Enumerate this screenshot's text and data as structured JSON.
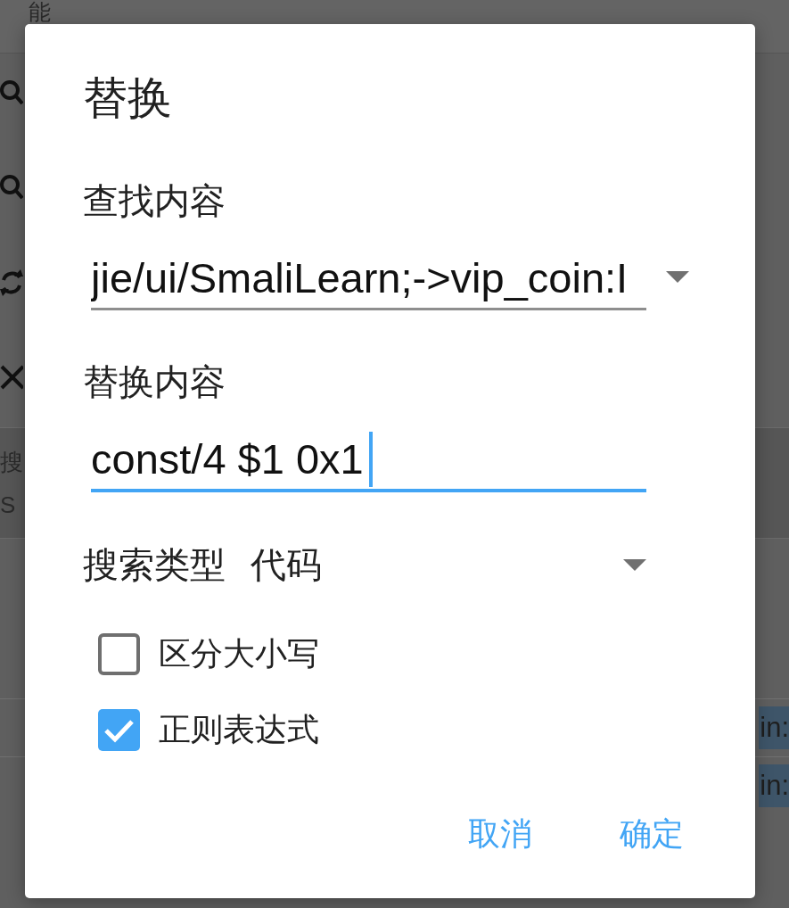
{
  "background": {
    "title": "能",
    "search_panel": {
      "lines": [
        "搜",
        "S"
      ]
    },
    "results": [
      {
        "text": "in:",
        "highlighted": true
      },
      {
        "text": "in:",
        "highlighted": true
      }
    ]
  },
  "dialog": {
    "title": "替换",
    "find": {
      "label": "查找内容",
      "value": "jie/ui/SmaliLearn;->vip_coin:I",
      "focused": false
    },
    "replace": {
      "label": "替换内容",
      "value": "const/4 $1 0x1",
      "focused": true
    },
    "search_type": {
      "label": "搜索类型",
      "value": "代码"
    },
    "options": [
      {
        "label": "区分大小写",
        "checked": false
      },
      {
        "label": "正则表达式",
        "checked": true
      }
    ],
    "buttons": [
      "取消",
      "确定"
    ]
  }
}
